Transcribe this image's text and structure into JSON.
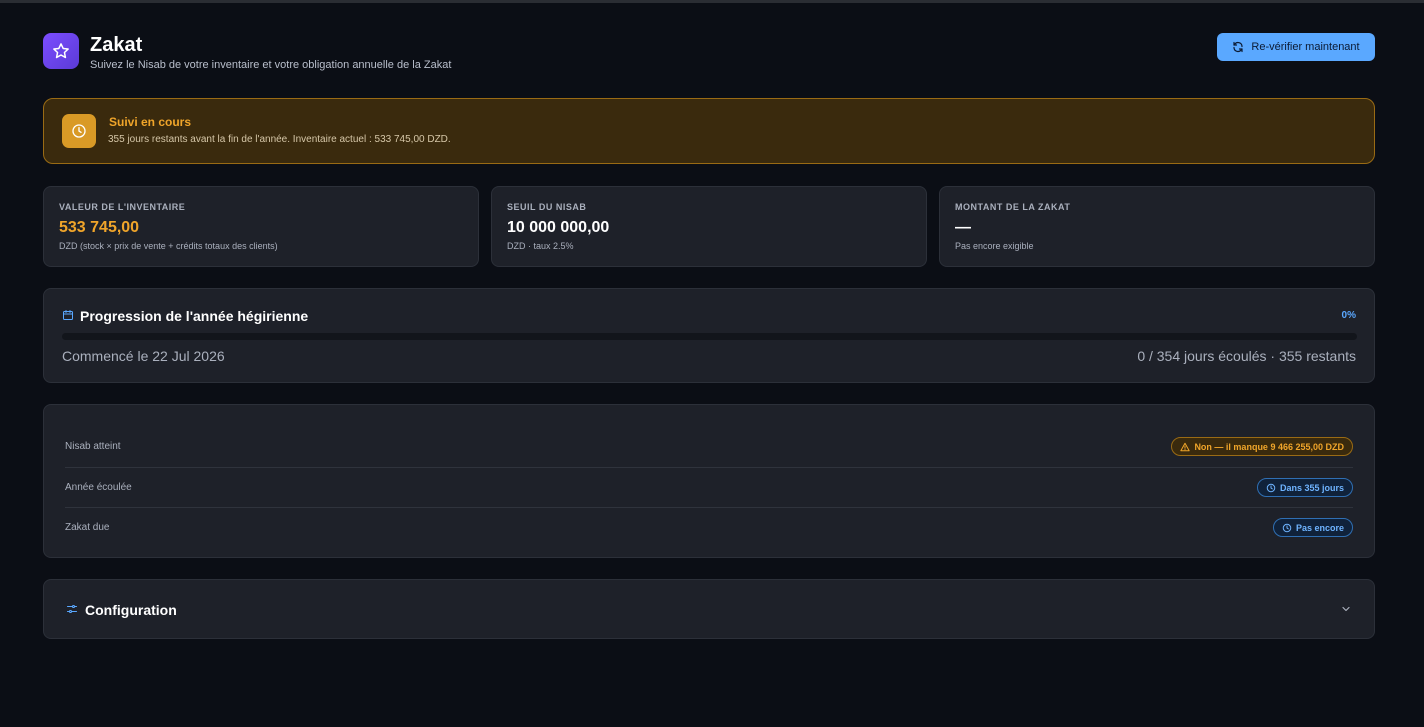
{
  "header": {
    "title": "Zakat",
    "subtitle": "Suivez le Nisab de votre inventaire et votre obligation annuelle de la Zakat",
    "app_icon": "star-icon",
    "recheck_label": "Re-vérifier maintenant",
    "recheck_icon": "refresh-icon"
  },
  "alert": {
    "icon": "clock-icon",
    "title": "Suivi en cours",
    "text": "355 jours restants avant la fin de l'année. Inventaire actuel : 533 745,00 DZD."
  },
  "cards": [
    {
      "label": "VALEUR DE L'INVENTAIRE",
      "value": "533 745,00",
      "note": "DZD (stock × prix de vente + crédits totaux des clients)"
    },
    {
      "label": "SEUIL DU NISAB",
      "value": "10 000 000,00",
      "note": "DZD · taux 2.5%"
    },
    {
      "label": "MONTANT DE LA ZAKAT",
      "value": "—",
      "note": "Pas encore exigible"
    }
  ],
  "progress": {
    "icon": "calendar-icon",
    "title": "Progression de l'année hégirienne",
    "percent_label": "0%",
    "percent": 0,
    "start_text": "Commencé le 22 Jul 2026",
    "days_text": "0 / 354 jours écoulés · 355 restants"
  },
  "status": [
    {
      "label": "Nisab atteint",
      "badge": "Non — il manque 9 466 255,00 DZD",
      "badge_icon": "warning-icon"
    },
    {
      "label": "Année écoulée",
      "badge": "Dans 355 jours",
      "badge_icon": "clock-icon"
    },
    {
      "label": "Zakat due",
      "badge": "Pas encore",
      "badge_icon": "clock-icon"
    }
  ],
  "config": {
    "icon": "sliders-icon",
    "title": "Configuration",
    "chevron": "chevron-down-icon"
  },
  "colors": {
    "background": "#0b0e15",
    "accent_blue": "#5aa8ff",
    "accent_orange": "#f0a52a",
    "brand_purple": "#7c4dff"
  }
}
